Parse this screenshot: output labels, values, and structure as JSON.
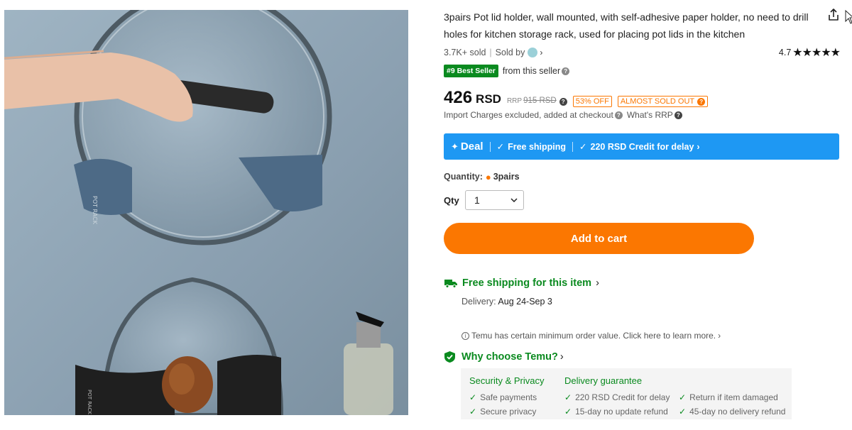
{
  "product": {
    "title": "3pairs Pot lid holder, wall mounted, with self-adhesive paper holder, no need to drill holes for kitchen storage rack, used for placing pot lids in the kitchen",
    "sold": "3.7K+ sold",
    "sold_by_label": "Sold by",
    "rating_value": "4.7",
    "stars": "★★★★★",
    "image_logo_text": "POT RACK"
  },
  "bestseller": {
    "badge": "#9 Best Seller",
    "text": "from this seller"
  },
  "price": {
    "amount": "426",
    "currency": "RSD",
    "rrp_label": "RRP",
    "rrp_value": "915 RSD",
    "discount": "53% OFF",
    "stock_status": "ALMOST SOLD OUT",
    "import_note": "Import Charges excluded, added at checkout",
    "whats_rrp": "What's RRP"
  },
  "deal": {
    "title": "Deal",
    "free_shipping": "Free shipping",
    "credit": "220 RSD Credit for delay"
  },
  "quantity": {
    "label": "Quantity:",
    "value": "3pairs",
    "qty_label": "Qty",
    "qty_selected": "1"
  },
  "cart": {
    "add_label": "Add to cart"
  },
  "shipping": {
    "title": "Free shipping for this item",
    "delivery_label": "Delivery:",
    "delivery_value": "Aug 24-Sep 3",
    "min_order": "Temu has certain minimum order value. Click here to learn more."
  },
  "why": {
    "title": "Why choose Temu?",
    "security_title": "Security & Privacy",
    "security_items": [
      "Safe payments",
      "Secure privacy"
    ],
    "delivery_title": "Delivery guarantee",
    "delivery_items": [
      "220 RSD Credit for delay",
      "Return if item damaged",
      "15-day no update refund",
      "45-day no delivery refund"
    ]
  },
  "colors": {
    "accent_orange": "#fb7701",
    "deal_blue": "#1e98f3",
    "green": "#0a8a1f"
  }
}
